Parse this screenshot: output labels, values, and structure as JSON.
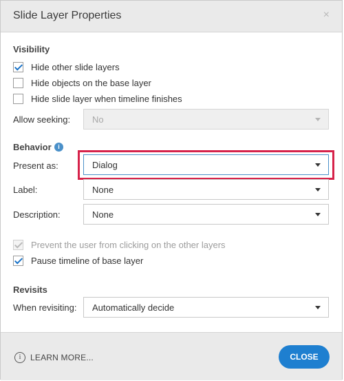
{
  "title": "Slide Layer Properties",
  "close_x": "×",
  "visibility": {
    "heading": "Visibility",
    "options": [
      {
        "label": "Hide other slide layers",
        "checked": true
      },
      {
        "label": "Hide objects on the base layer",
        "checked": false
      },
      {
        "label": "Hide slide layer when timeline finishes",
        "checked": false
      }
    ],
    "allow_seeking_label": "Allow seeking:",
    "allow_seeking_value": "No"
  },
  "behavior": {
    "heading": "Behavior",
    "info_icon": "i",
    "present_as_label": "Present as:",
    "present_as_value": "Dialog",
    "label_label": "Label:",
    "label_value": "None",
    "description_label": "Description:",
    "description_value": "None",
    "prevent_clicking_label": "Prevent the user from clicking on the other layers",
    "prevent_clicking_checked": true,
    "pause_timeline_label": "Pause timeline of base layer",
    "pause_timeline_checked": true
  },
  "revisits": {
    "heading": "Revisits",
    "when_label": "When revisiting:",
    "when_value": "Automatically decide"
  },
  "footer": {
    "learn_more": "LEARN MORE...",
    "info_glyph": "i",
    "close_label": "CLOSE"
  },
  "colors": {
    "accent": "#1e7fd0",
    "highlight": "#d6224a"
  }
}
